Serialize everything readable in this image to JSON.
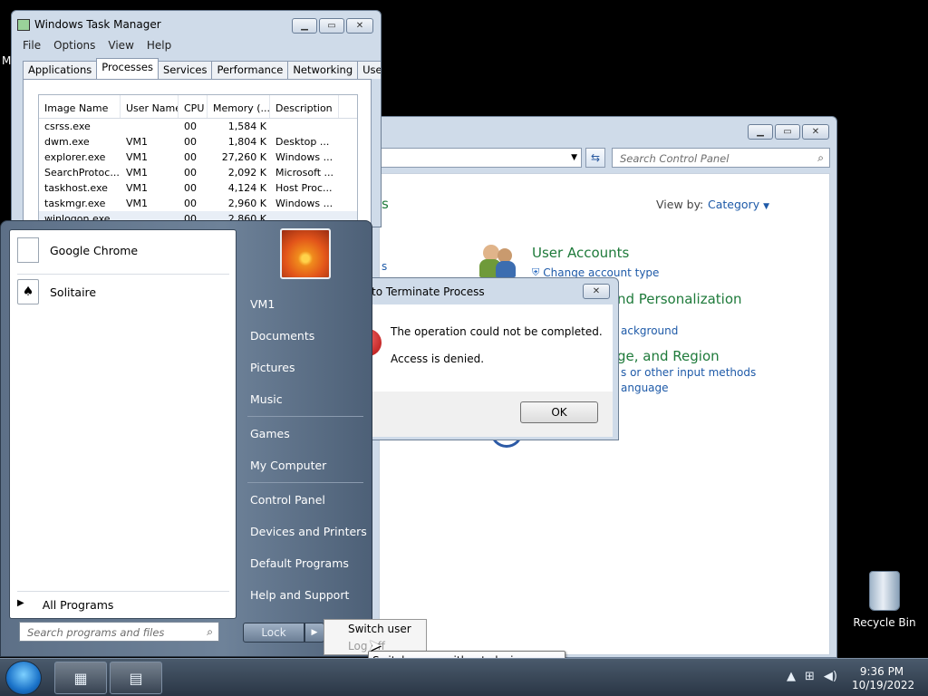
{
  "task_manager": {
    "title": "Windows Task Manager",
    "menu": [
      "File",
      "Options",
      "View",
      "Help"
    ],
    "tabs": [
      "Applications",
      "Processes",
      "Services",
      "Performance",
      "Networking",
      "Users"
    ],
    "active_tab": "Processes",
    "columns": [
      "Image Name",
      "User Name",
      "CPU",
      "Memory (...",
      "Description"
    ],
    "rows": [
      {
        "image": "csrss.exe",
        "user": "",
        "cpu": "00",
        "memory": "1,584 K",
        "desc": ""
      },
      {
        "image": "dwm.exe",
        "user": "VM1",
        "cpu": "00",
        "memory": "1,804 K",
        "desc": "Desktop ..."
      },
      {
        "image": "explorer.exe",
        "user": "VM1",
        "cpu": "00",
        "memory": "27,260 K",
        "desc": "Windows ..."
      },
      {
        "image": "SearchProtoc...",
        "user": "VM1",
        "cpu": "00",
        "memory": "2,092 K",
        "desc": "Microsoft ..."
      },
      {
        "image": "taskhost.exe",
        "user": "VM1",
        "cpu": "00",
        "memory": "4,124 K",
        "desc": "Host Proc..."
      },
      {
        "image": "taskmgr.exe",
        "user": "VM1",
        "cpu": "00",
        "memory": "2,960 K",
        "desc": "Windows ..."
      },
      {
        "image": "winlogon.exe",
        "user": "",
        "cpu": "00",
        "memory": "2,860 K",
        "desc": ""
      }
    ]
  },
  "control_panel": {
    "search_placeholder": "Search Control Panel",
    "view_by_label": "View by:",
    "view_by_value": "Category",
    "user_accounts_title": "User Accounts",
    "user_accounts_link": "Change account type",
    "appearance_title": "nd Personalization",
    "appearance_link": "ackground",
    "region_title": "ge, and Region",
    "region_link1": "s or other input methods",
    "region_link2": "anguage",
    "left_fragment1": "s",
    "left_fragment2": "s"
  },
  "error_dialog": {
    "title": "to Terminate Process",
    "message": "The operation could not be completed.",
    "detail": "Access is denied.",
    "ok_label": "OK"
  },
  "start_menu": {
    "pinned": [
      "Google Chrome",
      "Solitaire"
    ],
    "all_programs": "All Programs",
    "search_placeholder": "Search programs and files",
    "right_items": [
      "VM1",
      "Documents",
      "Pictures",
      "Music",
      "Games",
      "My Computer",
      "Control Panel",
      "Devices and Printers",
      "Default Programs",
      "Help and Support"
    ],
    "lock_label": "Lock",
    "submenu": [
      "Switch user",
      "Log off"
    ],
    "tooltip": "Switch users without closing programs."
  },
  "desktop": {
    "recycle_bin": "Recycle Bin",
    "left_fragment": "M"
  },
  "taskbar": {
    "time": "9:36 PM",
    "date": "10/19/2022"
  }
}
